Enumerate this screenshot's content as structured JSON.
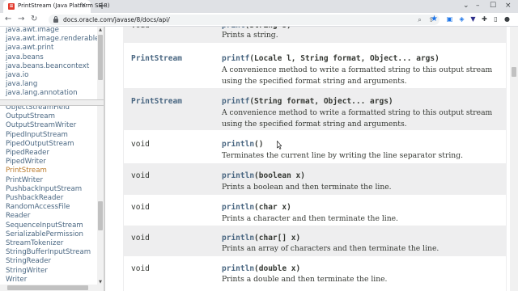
{
  "browser": {
    "tab_title": "PrintStream (Java Platform SE 8)",
    "tab_close": "×",
    "new_tab": "+",
    "url": "docs.oracle.com/javase/8/docs/api/",
    "window_controls": [
      "⌄",
      "–",
      "☐",
      "×"
    ],
    "nav": {
      "back": "←",
      "forward": "→",
      "reload": "↻"
    }
  },
  "packages": [
    "java.awt.image",
    "java.awt.image.renderable",
    "java.awt.print",
    "java.beans",
    "java.beans.beancontext",
    "java.io",
    "java.lang",
    "java.lang.annotation"
  ],
  "classes": {
    "active": "PrintStream",
    "items": [
      "ObjectStreamField",
      "OutputStream",
      "OutputStreamWriter",
      "PipedInputStream",
      "PipedOutputStream",
      "PipedReader",
      "PipedWriter",
      "PrintStream",
      "PrintWriter",
      "PushbackInputStream",
      "PushbackReader",
      "RandomAccessFile",
      "Reader",
      "SequenceInputStream",
      "SerializablePermission",
      "StreamTokenizer",
      "StringBufferInputStream",
      "StringReader",
      "StringWriter",
      "Writer"
    ]
  },
  "methods": [
    {
      "type": "void",
      "type_link": false,
      "name": "print",
      "params": "(String s)",
      "desc": "Prints a string."
    },
    {
      "type": "PrintStream",
      "type_link": true,
      "name": "printf",
      "params": "(Locale l, String format, Object... args)",
      "desc": "A convenience method to write a formatted string to this output stream using the specified format string and arguments."
    },
    {
      "type": "PrintStream",
      "type_link": true,
      "name": "printf",
      "params": "(String format, Object... args)",
      "desc": "A convenience method to write a formatted string to this output stream using the specified format string and arguments."
    },
    {
      "type": "void",
      "type_link": false,
      "name": "println",
      "params": "()",
      "desc": "Terminates the current line by writing the line separator string."
    },
    {
      "type": "void",
      "type_link": false,
      "name": "println",
      "params": "(boolean x)",
      "desc": "Prints a boolean and then terminate the line."
    },
    {
      "type": "void",
      "type_link": false,
      "name": "println",
      "params": "(char x)",
      "desc": "Prints a character and then terminate the line."
    },
    {
      "type": "void",
      "type_link": false,
      "name": "println",
      "params": "(char[] x)",
      "desc": "Prints an array of characters and then terminate the line."
    },
    {
      "type": "void",
      "type_link": false,
      "name": "println",
      "params": "(double x)",
      "desc": "Prints a double and then terminate the line."
    }
  ]
}
